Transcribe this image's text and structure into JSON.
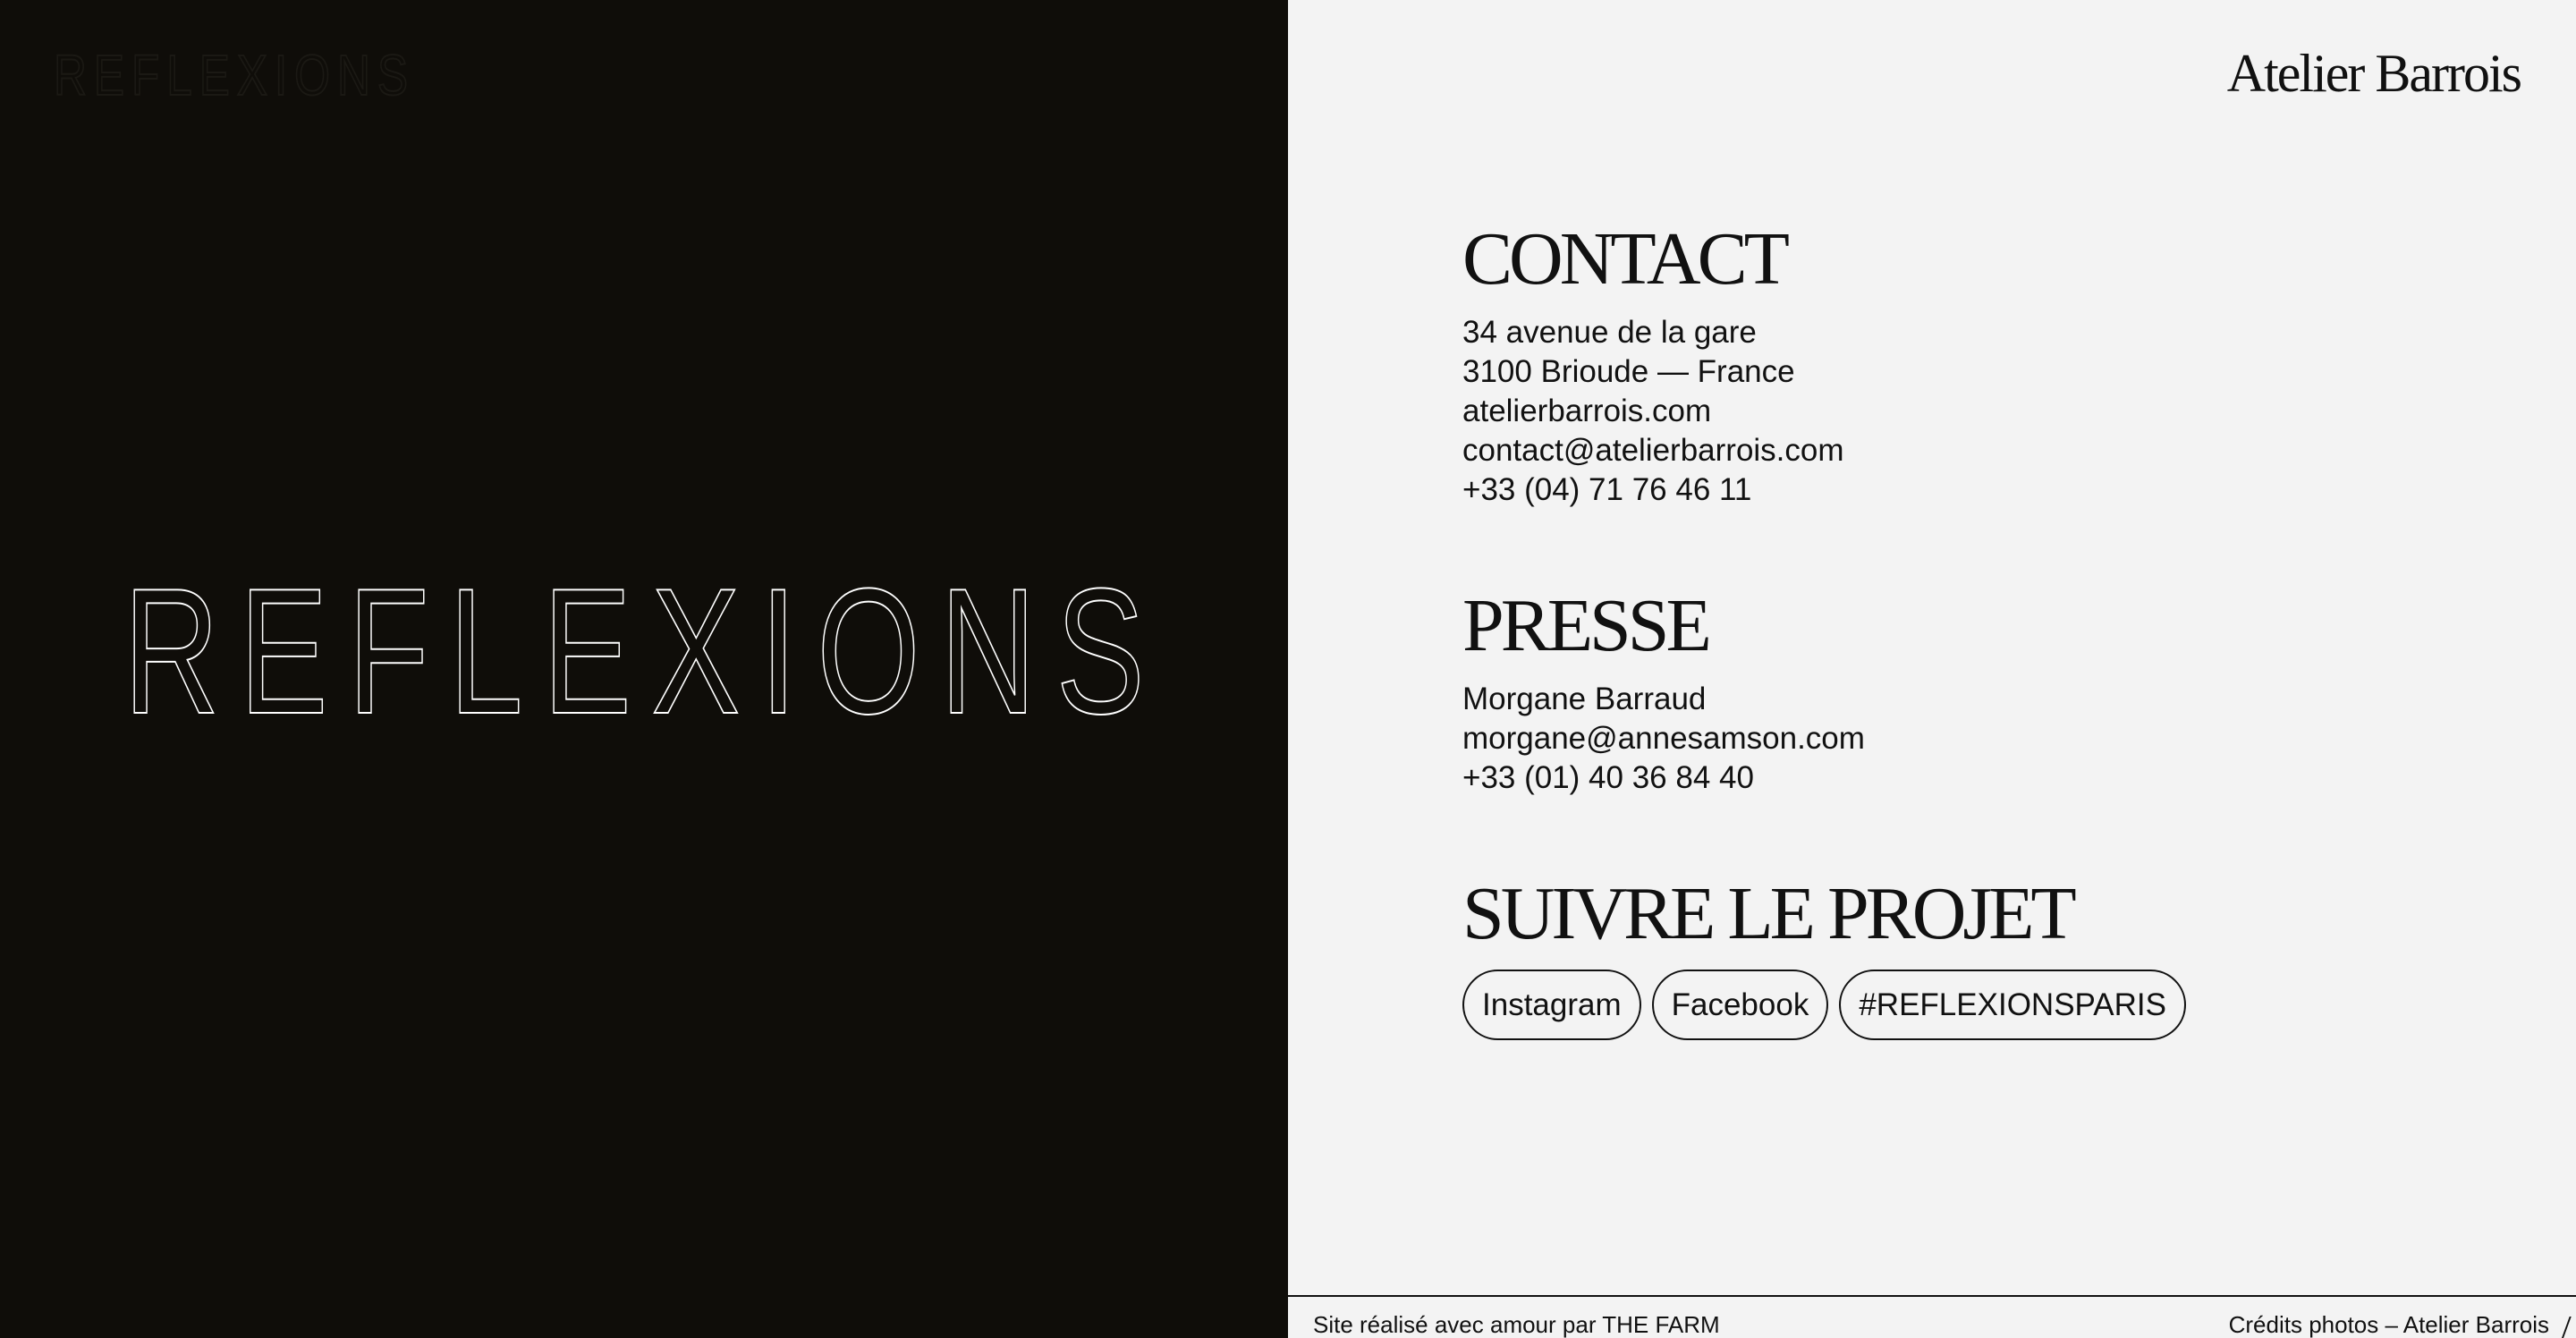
{
  "left": {
    "top_logo_text": "REFLEXIONS",
    "hero_logo_text": "REFLEXIONS"
  },
  "brand": {
    "name": "Atelier Barrois"
  },
  "contact": {
    "title": "CONTACT",
    "lines": [
      "34 avenue de la gare",
      "3100 Brioude — France",
      "atelierbarrois.com",
      "contact@atelierbarrois.com",
      "+33 (04) 71 76 46 11"
    ]
  },
  "presse": {
    "title": "PRESSE",
    "lines": [
      "Morgane Barraud",
      "morgane@annesamson.com",
      "+33 (01) 40 36 84 40"
    ]
  },
  "follow": {
    "title": "SUIVRE LE PROJET",
    "links": [
      "Instagram",
      "Facebook",
      "#REFLEXIONSPARIS"
    ]
  },
  "footer": {
    "left": "Site réalisé avec amour par THE FARM",
    "right": "Crédits photos – Atelier Barrois"
  },
  "colors": {
    "left_bg": "#0f0d09",
    "right_bg": "#f3f3f3",
    "text": "#111111"
  },
  "icons": {
    "corner_mark": "slash-mark-icon"
  }
}
